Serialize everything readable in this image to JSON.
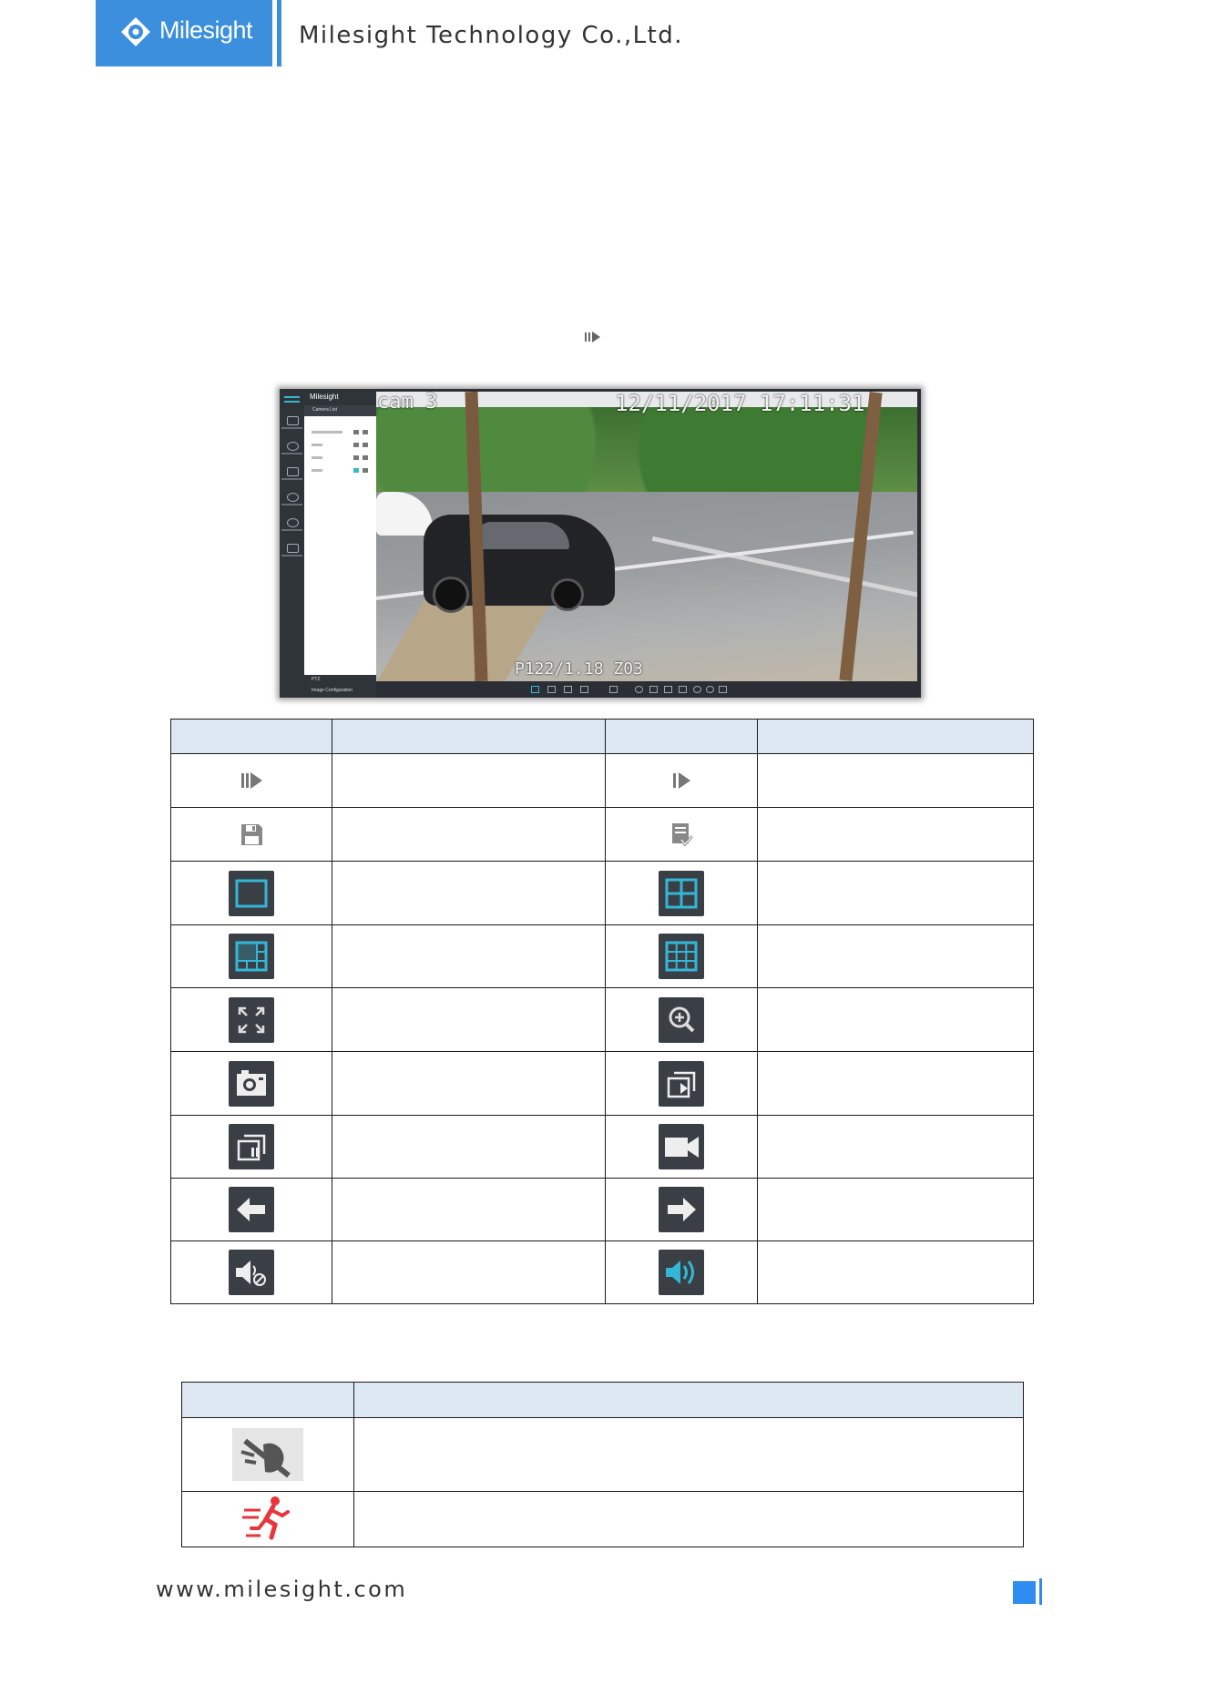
{
  "header": {
    "brand": "Milesight",
    "company": "Milesight Technology Co.,Ltd."
  },
  "screenshot": {
    "app_brand": "Milesight",
    "panel_title": "Camera List",
    "osd_camera": "cam 3",
    "osd_datetime": "12/11/2017 17:11:31",
    "osd_bottom": "P122/1.18 Z03",
    "panel_footer_1": "PTZ",
    "panel_footer_2": "Image Configuration"
  },
  "icon_table": {
    "rows": [
      {
        "left_icon": "play-pause-icon",
        "right_icon": "play-icon"
      },
      {
        "left_icon": "save-icon",
        "right_icon": "save-list-icon"
      },
      {
        "left_icon": "single-layout-icon",
        "right_icon": "four-layout-icon"
      },
      {
        "left_icon": "six-layout-icon",
        "right_icon": "nine-layout-icon"
      },
      {
        "left_icon": "fullscreen-icon",
        "right_icon": "zoom-in-icon"
      },
      {
        "left_icon": "snapshot-icon",
        "right_icon": "play-all-icon"
      },
      {
        "left_icon": "pause-all-icon",
        "right_icon": "record-icon"
      },
      {
        "left_icon": "previous-arrow-icon",
        "right_icon": "next-arrow-icon"
      },
      {
        "left_icon": "mute-icon",
        "right_icon": "volume-icon"
      }
    ]
  },
  "status_table": {
    "rows": [
      {
        "icon": "video-loss-icon"
      },
      {
        "icon": "motion-detection-icon"
      }
    ]
  },
  "footer": {
    "website": "www.milesight.com"
  },
  "colors": {
    "brand_blue": "#3b8fdc",
    "accent_cyan": "#33b7d6",
    "table_header": "#dde8f2",
    "icon_bg": "#3a3f46",
    "alarm_red": "#e8343a"
  }
}
